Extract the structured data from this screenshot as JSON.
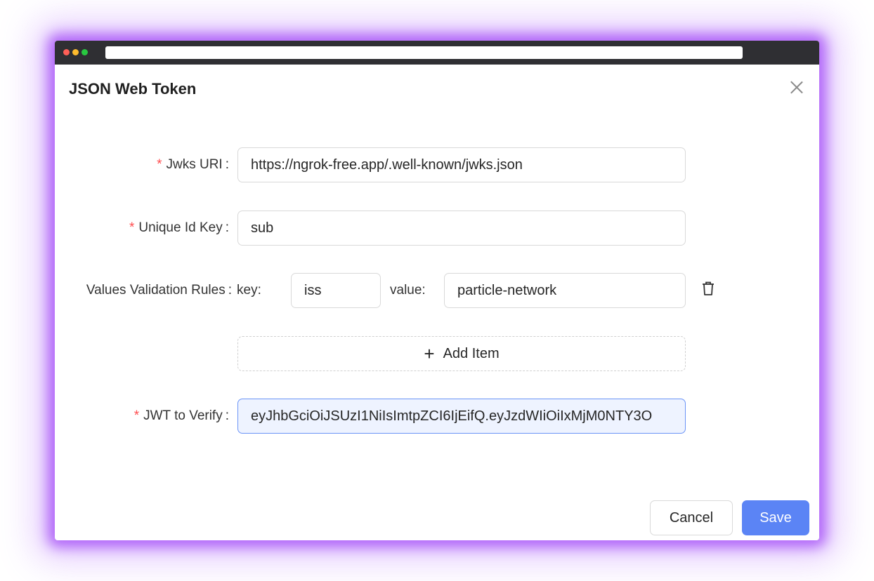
{
  "dialog": {
    "title": "JSON Web Token",
    "close_icon": "close-icon"
  },
  "form": {
    "jwks_uri": {
      "required_mark": "*",
      "label": "Jwks URI",
      "colon": ":",
      "value": "https://ngrok-free.app/.well-known/jwks.json"
    },
    "unique_id_key": {
      "required_mark": "*",
      "label": "Unique Id Key",
      "colon": ":",
      "value": "sub"
    },
    "validation_rules": {
      "label": "Values Validation Rules",
      "colon": ":",
      "rules": [
        {
          "key_label": "key:",
          "key": "iss",
          "value_label": "value:",
          "value": "particle-network",
          "delete_icon": "trash-icon"
        }
      ],
      "add_item_label": "Add Item",
      "add_icon": "plus-icon"
    },
    "jwt_to_verify": {
      "required_mark": "*",
      "label": "JWT to Verify",
      "colon": ":",
      "value": "eyJhbGciOiJSUzI1NiIsImtpZCI6IjEifQ.eyJzdWIiOiIxMjM0NTY3O"
    }
  },
  "footer": {
    "cancel_label": "Cancel",
    "save_label": "Save"
  },
  "colors": {
    "accent": "#5b84f5",
    "required": "#ff4d4f",
    "glow": "#a855f7"
  }
}
